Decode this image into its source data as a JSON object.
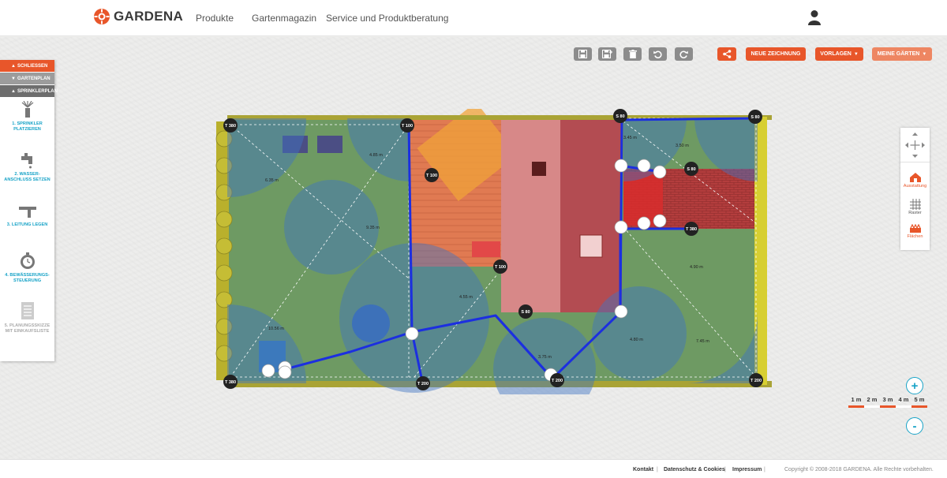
{
  "brand": {
    "name": "GARDENA",
    "accent": "#e8562a",
    "link": "#17a3c7"
  },
  "nav": {
    "items": [
      "Produkte",
      "Gartenmagazin",
      "Service und Produktberatung"
    ],
    "user_icon": "user-icon"
  },
  "side_panel": {
    "close_label": "Schliessen",
    "garden_label": "Gartenplan",
    "sprinkler_label": "Sprinklerplan",
    "steps": [
      {
        "label": "1. Sprinkler\nplatzieren",
        "icon": "sprinkler-icon"
      },
      {
        "label": "2. Wasser-\nanschluss setzen",
        "icon": "water-tap-icon"
      },
      {
        "label": "3. Leitung legen",
        "icon": "pipe-icon"
      },
      {
        "label": "4. Bewässerungs-\nsteuerung",
        "icon": "timer-icon"
      },
      {
        "label": "5. Planungsskizze\nmit Einkaufsliste",
        "icon": "list-icon"
      }
    ]
  },
  "toolbar": {
    "icons": [
      "save-icon",
      "save-as-icon",
      "trash-icon",
      "undo-icon",
      "redo-icon",
      "share-icon"
    ],
    "new_drawing": "Neue Zeichnung",
    "templates": "Vorlagen",
    "my_gardens": "Meine Gärten"
  },
  "right_panel": {
    "equipment": "Ausstattung",
    "grid": "Raster",
    "areas": "Flächen"
  },
  "plan": {
    "sprinklers": [
      "T 380",
      "T 100",
      "T 380",
      "S 80",
      "S 80",
      "S 80",
      "T 100",
      "T 100",
      "S 80",
      "T 380",
      "T 200",
      "T 200",
      "T 200"
    ],
    "distances": [
      "4.85 m",
      "6.35 m",
      "9.35 m",
      "3.45 m",
      "3.50 m",
      "4.55 m",
      "10.56 m",
      "3.75 m",
      "4.80 m",
      "7.45 m",
      "4.90 m"
    ]
  },
  "scale": {
    "labels": [
      "1 m",
      "2 m",
      "3 m",
      "4 m",
      "5 m"
    ]
  },
  "footer": {
    "links": [
      "Kontakt",
      "Datenschutz & Cookies",
      "Impressum"
    ],
    "copyright": "Copyright © 2008-2018 GARDENA. Alle Rechte vorbehalten."
  }
}
